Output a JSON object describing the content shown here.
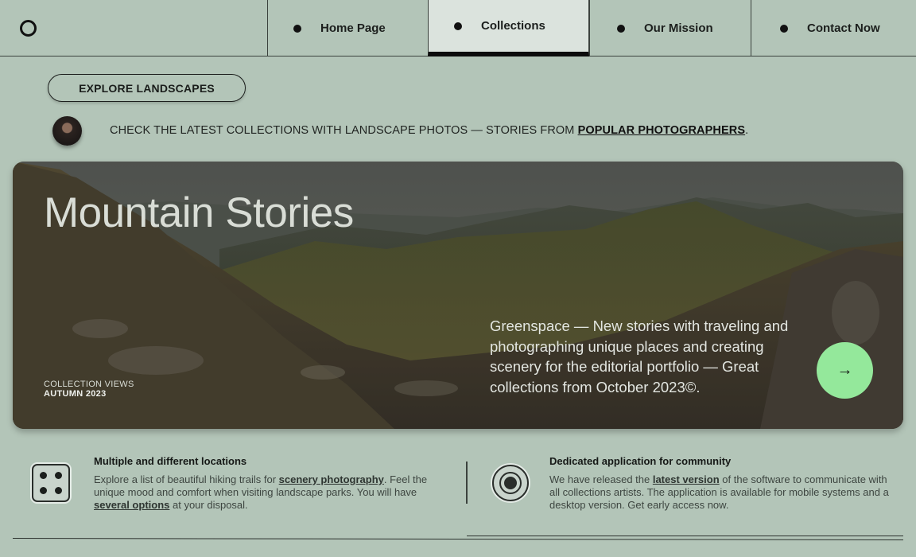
{
  "nav": {
    "items": [
      {
        "label": "Home Page"
      },
      {
        "label": "Collections"
      },
      {
        "label": "Our Mission"
      },
      {
        "label": "Contact Now"
      }
    ]
  },
  "explore_button": "EXPLORE LANDSCAPES",
  "promo": {
    "text": "CHECK THE LATEST COLLECTIONS WITH LANDSCAPE PHOTOS — STORIES FROM ",
    "link": "POPULAR PHOTOGRAPHERS",
    "end": "."
  },
  "hero": {
    "title": "Mountain Stories",
    "caption_line1": "COLLECTION VIEWS",
    "caption_line2": "AUTUMN 2023",
    "description": "Greenspace — New stories with traveling and photographing unique places and creating scenery for the editorial portfolio — Great collections from October 2023©.",
    "arrow": "→",
    "arrow_color": "#94e89b"
  },
  "features": [
    {
      "title": "Multiple and different locations",
      "text_a": "Explore a list of beautiful hiking trails for ",
      "link_a": "scenery photography",
      "text_b": ". Feel the unique mood and comfort when visiting landscape parks. You will have ",
      "link_b": "several options",
      "text_c": " at your disposal."
    },
    {
      "title": "Dedicated application for community",
      "text_a": "We have released the ",
      "link_a": "latest version",
      "text_b": " of the software to communicate with all collections artists. The application is available for mobile systems and a desktop version. Get early access now."
    }
  ]
}
